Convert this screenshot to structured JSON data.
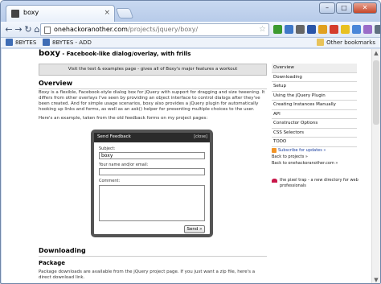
{
  "browser": {
    "tab_title": "boxy",
    "tab_close": "×",
    "window_buttons": [
      "–",
      "□",
      "✕"
    ],
    "url_host": "onehackoranother.com",
    "url_path": "/projects/jquery/boxy/",
    "nav": {
      "back": "←",
      "forward": "→",
      "reload": "↻",
      "home": "⌂"
    },
    "star": "☆",
    "toolbar_icon_colors": [
      "#3c9a2f",
      "#3f78c8",
      "#666666",
      "#2a55a8",
      "#e0a020",
      "#d43c2c",
      "#e8c020",
      "#4a86d8",
      "#9a6cc8",
      "#607080"
    ]
  },
  "bookmarks": {
    "items": [
      "8BYTES",
      "8BYTES - ADD"
    ],
    "other": "Other bookmarks"
  },
  "page": {
    "title": "boxy",
    "subtitle": " - Facebook-like dialog/overlay, with frills",
    "notice": "Visit the test & examples page - gives all of Boxy's major features a workout",
    "overview_heading": "Overview",
    "overview_p1": "Boxy is a flexible, Facebook-style dialog box for jQuery with support for dragging and size tweening. It differs from other overlays I've seen by providing an object interface to control dialogs after they've been created. And for simple usage scenarios, boxy also provides a jQuery plugin for automatically hooking up links and forms, as well as an ask() helper for presenting multiple choices to the user.",
    "overview_p2": "Here's an example, taken from the old feedback forms on my project pages:",
    "downloading_heading": "Downloading",
    "package_heading": "Package",
    "package_text": "Package downloads are available from the jQuery project page. If you just want a zip file, here's a direct download link."
  },
  "dialog": {
    "title": "Send Feedback",
    "close": "[close]",
    "subject_label": "Subject:",
    "subject_value": "boxy",
    "email_label": "Your name and/or email:",
    "comment_label": "Comment:",
    "send_label": "Send »"
  },
  "sidebar": {
    "items": [
      "Overview",
      "Downloading",
      "Setup",
      "Using the jQuery Plugin",
      "Creating Instances Manually",
      "API",
      "Constructor Options",
      "CSS Selectors",
      "TODO"
    ],
    "subscribe": "Subscribe for updates »",
    "back_projects": "Back to projects »",
    "back_site": "Back to onehackoranother.com »",
    "pixel_trap": "the pixel trap - a new directory for web professionals"
  }
}
